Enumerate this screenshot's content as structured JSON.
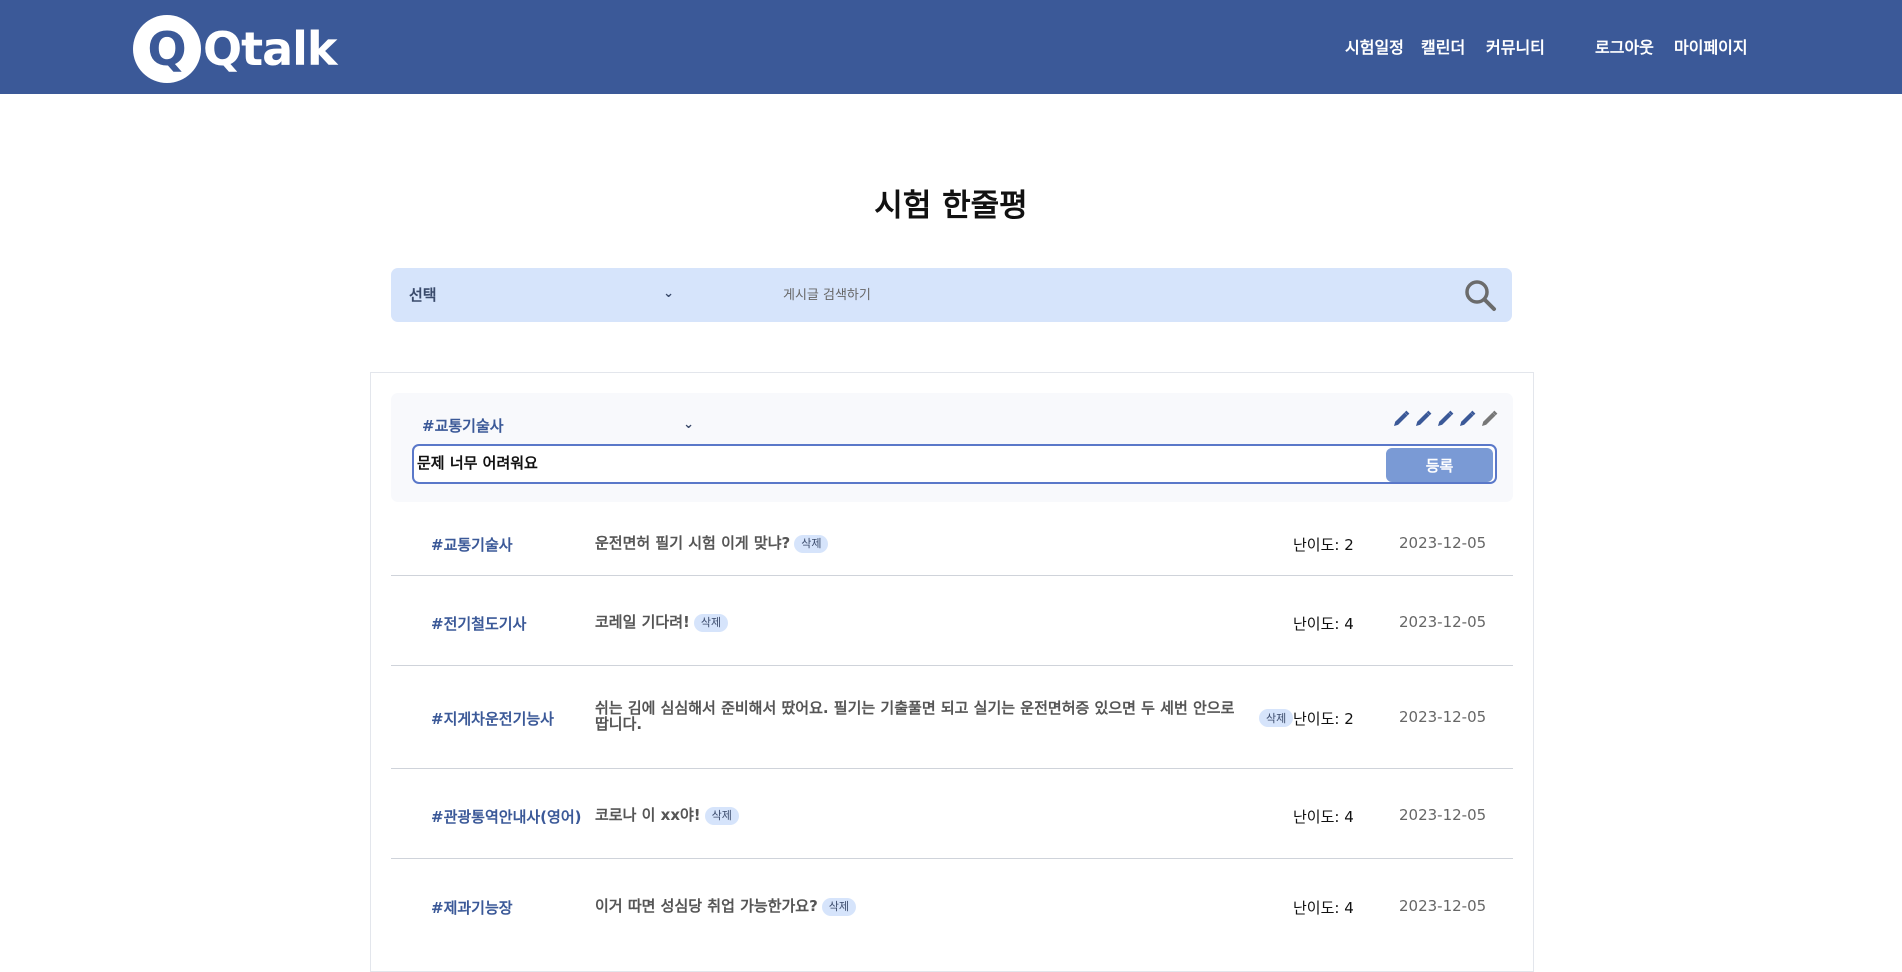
{
  "header": {
    "logo_letter": "Q",
    "logo_text": "Qtalk",
    "nav": {
      "schedule": "시험일정",
      "calendar": "캘린더",
      "community": "커뮤니티",
      "logout": "로그아웃",
      "mypage": "마이페이지"
    },
    "brand_color": "#3b5998"
  },
  "page": {
    "title": "시험 한줄평"
  },
  "search": {
    "select_value": "선택",
    "placeholder": "게시글 검색하기"
  },
  "compose": {
    "select_value": "#교통기술사",
    "difficulty_icons": 5,
    "difficulty_selected": 4,
    "input_value": "문제 너무 어려워요",
    "submit_label": "등록"
  },
  "reviews": [
    {
      "tag": "#교통기술사",
      "content": "운전면허 필기 시험 이게 맞냐?",
      "delete_label": "삭제",
      "difficulty": "난이도: 2",
      "date": "2023-12-05"
    },
    {
      "tag": "#전기철도기사",
      "content": "코레일 기다려!",
      "delete_label": "삭제",
      "difficulty": "난이도: 4",
      "date": "2023-12-05"
    },
    {
      "tag": "#지게차운전기능사",
      "content": "쉬는 김에 심심해서 준비해서 땄어요. 필기는 기출풀면 되고 실기는 운전면허증 있으면 두 세번 안으로 땁니다.",
      "delete_label": "삭제",
      "difficulty": "난이도: 2",
      "date": "2023-12-05"
    },
    {
      "tag": "#관광통역안내사(영어)",
      "content": "코로나 이 xx야!",
      "delete_label": "삭제",
      "difficulty": "난이도: 4",
      "date": "2023-12-05"
    },
    {
      "tag": "#제과기능장",
      "content": "이거 따면 성심당 취업 가능한가요?",
      "delete_label": "삭제",
      "difficulty": "난이도: 4",
      "date": "2023-12-05"
    }
  ]
}
